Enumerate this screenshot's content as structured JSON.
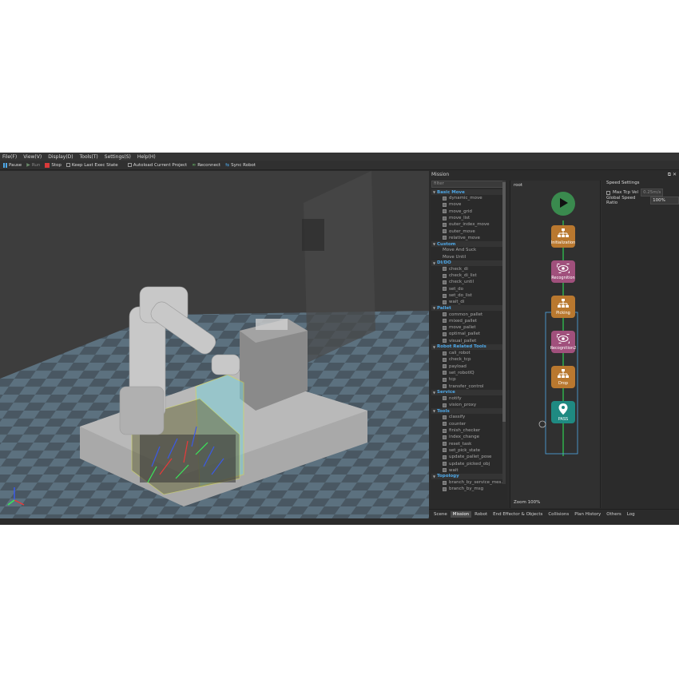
{
  "menu": [
    "File(F)",
    "View(V)",
    "Display(D)",
    "Tools(T)",
    "Settings(S)",
    "Help(H)"
  ],
  "toolbar": {
    "pause": "Pause",
    "run": "Run",
    "stop": "Stop",
    "keep_last": "Keep Last Exec State",
    "autoload": "Autoload Current Project",
    "reconnect": "Reconnect",
    "sync_robot": "Sync Robot"
  },
  "mission": {
    "title": "Mission",
    "filter_placeholder": "filter",
    "categories": [
      {
        "name": "Basic Move",
        "items": [
          "dynamic_move",
          "move",
          "move_grid",
          "move_list",
          "outer_index_move",
          "outer_move",
          "relative_move"
        ]
      },
      {
        "name": "Custom",
        "items": [
          "Move And Suck",
          "Move Until"
        ],
        "plain": true
      },
      {
        "name": "DI/DO",
        "items": [
          "check_di",
          "check_di_list",
          "check_until",
          "set_do",
          "set_do_list",
          "wait_di"
        ]
      },
      {
        "name": "Pallet",
        "items": [
          "common_pallet",
          "mixed_pallet",
          "move_pallet",
          "optimal_pallet",
          "visual_pallet"
        ]
      },
      {
        "name": "Robot Related Tools",
        "items": [
          "cali_robot",
          "check_tcp",
          "payload",
          "set_robotIQ",
          "tcp",
          "transfer_control"
        ]
      },
      {
        "name": "Service",
        "items": [
          "notify",
          "vision_proxy"
        ]
      },
      {
        "name": "Tools",
        "items": [
          "classify",
          "counter",
          "finish_checker",
          "index_change",
          "reset_task",
          "set_pick_state",
          "update_pallet_pose",
          "update_picked_obj",
          "wait"
        ]
      },
      {
        "name": "Topology",
        "items": [
          "branch_by_service_mes...",
          "branch_by_msg"
        ]
      }
    ],
    "breadcrumb": "root",
    "zoom": "Zoom 100%",
    "nodes": [
      {
        "label": "",
        "icon": "play-icon",
        "color": "#3a8a4e"
      },
      {
        "label": "Initialization",
        "icon": "hierarchy-icon",
        "color": "#b9782f"
      },
      {
        "label": "Recognition",
        "icon": "eye-icon",
        "color": "#a0507c"
      },
      {
        "label": "Picking",
        "icon": "hierarchy-icon",
        "color": "#b9782f"
      },
      {
        "label": "Recognition2",
        "icon": "eye-icon",
        "color": "#a0507c"
      },
      {
        "label": "Drop",
        "icon": "hierarchy-icon",
        "color": "#b9782f"
      },
      {
        "label": "PASS",
        "icon": "location-pin-icon",
        "color": "#1f8a82"
      }
    ]
  },
  "speed": {
    "title": "Speed Settings",
    "max_tcp_label": "Max Tcp Vel",
    "max_tcp_value": "0.25m/s",
    "global_label": "Global Speed Ratio",
    "global_value": "100%"
  },
  "tabs": [
    "Scene",
    "Mission",
    "Robot",
    "End Effector & Objects",
    "Collisions",
    "Plan History",
    "Others",
    "Log"
  ],
  "active_tab": "Mission",
  "colors": {
    "accent": "#4ea8e8",
    "stop": "#d93a3a",
    "pause": "#4ea8e8"
  }
}
